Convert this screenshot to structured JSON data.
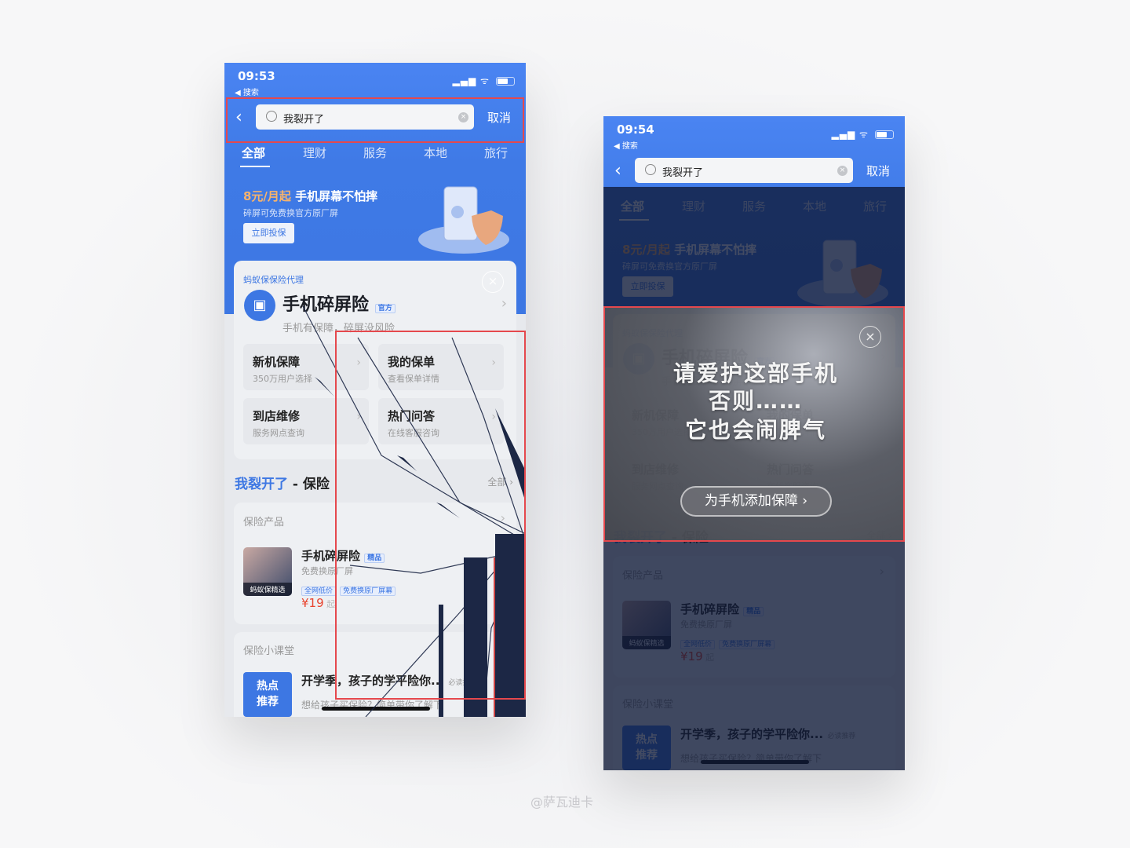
{
  "left_phone": {
    "time": "09:53"
  },
  "right_phone": {
    "time": "09:54"
  },
  "status": {
    "back_app": "◀ 搜索",
    "signal": "▂▄▆ ◠"
  },
  "search": {
    "query": "我裂开了",
    "cancel": "取消"
  },
  "tabs": [
    "全部",
    "理财",
    "服务",
    "本地",
    "旅行"
  ],
  "banner": {
    "highlight": "8元/月起",
    "title": "手机屏幕不怕摔",
    "subtitle": "碎屏可免费换官方原厂屏",
    "button": "立即投保"
  },
  "product_card": {
    "agent": "蚂蚁保保险代理",
    "title": "手机碎屏险",
    "badge": "官方",
    "subtitle": "手机有保障，碎屏没风险",
    "grid": [
      {
        "title": "新机保障",
        "sub": "350万用户选择"
      },
      {
        "title": "我的保单",
        "sub": "查看保单详情"
      },
      {
        "title": "到店维修",
        "sub": "服务网点查询"
      },
      {
        "title": "热门问答",
        "sub": "在线客服咨询"
      }
    ]
  },
  "section": {
    "query": "我裂开了",
    "suffix": " - 保险",
    "all": "全部 ›"
  },
  "products": {
    "header": "保险产品",
    "title": "手机碎屏险",
    "badge": "精品",
    "desc": "免费换原厂屏",
    "tags": [
      "全网低价",
      "免费换原厂屏幕"
    ],
    "price": "¥19",
    "price_suffix": " 起",
    "thumb_label": "蚂蚁保精选"
  },
  "lesson": {
    "header": "保险小课堂",
    "hot": "热点\n推荐",
    "hot1": "热点",
    "hot2": "推荐",
    "title": "开学季，孩子的学平险你...",
    "badge": "必读推荐",
    "subtitle": "想给孩子买保险？简单带你了解下"
  },
  "popup": {
    "line1": "请爱护这部手机",
    "line2": "否则……",
    "line3": "它也会闹脾气",
    "button": "为手机添加保障 ›"
  },
  "watermark": "@萨瓦迪卡",
  "colors": {
    "brand_blue": "#3d77e3",
    "price_red": "#e8442e",
    "highlight_orange": "#f7b36b",
    "annotation_red": "#e5484d"
  }
}
